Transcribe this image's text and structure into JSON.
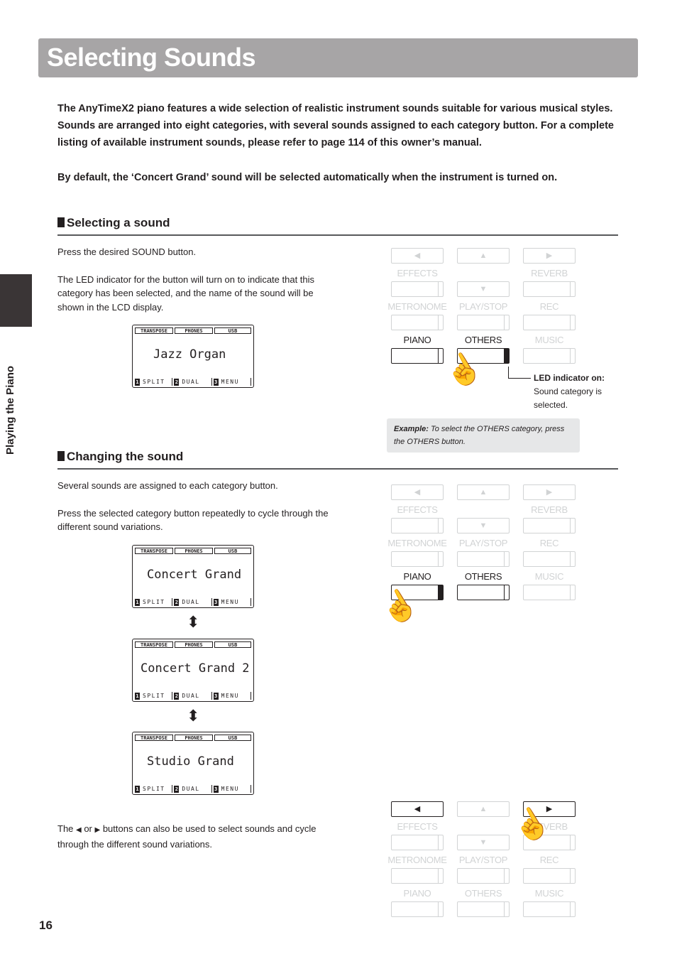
{
  "page": {
    "title": "Selecting Sounds",
    "side_tab_label": "Playing the Piano",
    "page_number": "16"
  },
  "intro": {
    "paragraph1": "The AnyTimeX2 piano features a wide selection of realistic instrument sounds suitable for various musical styles. Sounds are arranged into eight categories, with several sounds assigned to each category button.  For a complete listing of available instrument sounds, please refer to page 114 of this owner’s manual.",
    "paragraph2": "By default, the ‘Concert Grand’ sound will be selected automatically when the instrument is turned on."
  },
  "section1": {
    "heading": "Selecting a sound",
    "p1": "Press the desired SOUND button.",
    "p2": "The LED indicator for the button will turn on to indicate that this category has been selected, and the name of the sound will be shown in the LCD display.",
    "lcd_name": "Jazz Organ",
    "led_note_bold": "LED indicator on:",
    "led_note_text": "Sound category is selected.",
    "example_bold": "Example:",
    "example_text": " To select the OTHERS category, press the OTHERS button."
  },
  "section2": {
    "heading": "Changing the sound",
    "p1": "Several sounds are assigned to each category button.",
    "p2": "Press the selected category button repeatedly to cycle through the different sound variations.",
    "lcd_names": [
      "Concert Grand",
      "Concert Grand 2",
      "Studio Grand"
    ],
    "p3_a": "The ",
    "p3_left": "◀",
    "p3_or": " or ",
    "p3_right": "▶",
    "p3_b": " buttons can also be used to select sounds and cycle through the different sound variations."
  },
  "lcd": {
    "top_tabs": [
      "TRANSPOSE",
      "PHONES",
      "USB"
    ],
    "bottom_tabs": [
      {
        "num": "1",
        "label": "SPLIT"
      },
      {
        "num": "2",
        "label": "DUAL"
      },
      {
        "num": "3",
        "label": "MENU"
      }
    ]
  },
  "panel": {
    "labels": {
      "effects": "EFFECTS",
      "reverb": "REVERB",
      "metronome": "METRONOME",
      "play_stop": "PLAY/STOP",
      "rec": "REC",
      "piano": "PIANO",
      "others": "OTHERS",
      "music": "MUSIC"
    },
    "icons": {
      "left": "◀",
      "up": "▲",
      "right": "▶",
      "down": "▼",
      "hand": "☝"
    }
  },
  "colors": {
    "title_bar": "#a7a5a6",
    "inactive_button": "#d1d3d4",
    "active": "#231f20",
    "led_lit": "#939598",
    "note_bg": "#e6e7e8"
  }
}
